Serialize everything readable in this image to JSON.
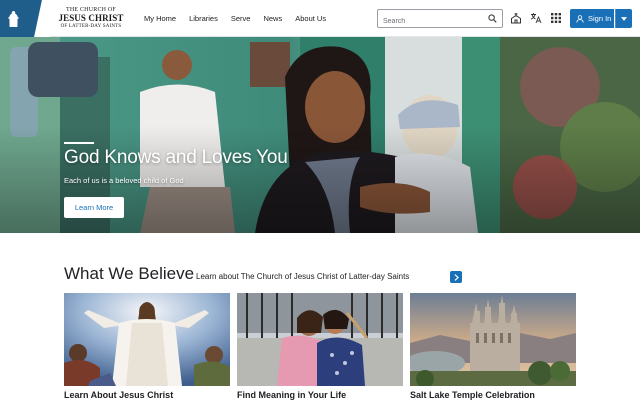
{
  "header": {
    "logo": {
      "line1": "THE CHURCH OF",
      "line2": "JESUS CHRIST",
      "line3": "OF LATTER-DAY SAINTS"
    },
    "nav": [
      "My Home",
      "Libraries",
      "Serve",
      "News",
      "About Us"
    ],
    "search_placeholder": "Search",
    "icons": [
      "search-icon",
      "meetinghouse-icon",
      "language-icon",
      "apps-grid-icon",
      "user-icon",
      "chevron-down-icon"
    ],
    "signin_label": "Sign In"
  },
  "hero": {
    "title": "God Knows and Loves You",
    "subtitle": "Each of us is a beloved child of God",
    "button_label": "Learn More"
  },
  "believe": {
    "title": "What We Believe",
    "link_label": "Learn about The Church of Jesus Christ of Latter-day Saints",
    "cards": [
      {
        "caption": "Learn About Jesus Christ"
      },
      {
        "caption": "Find Meaning in Your Life"
      },
      {
        "caption": "Salt Lake Temple Celebration"
      }
    ]
  },
  "colors": {
    "brand_blue": "#1a70b7",
    "logo_blue": "#1f5e8a",
    "text": "#212225"
  }
}
